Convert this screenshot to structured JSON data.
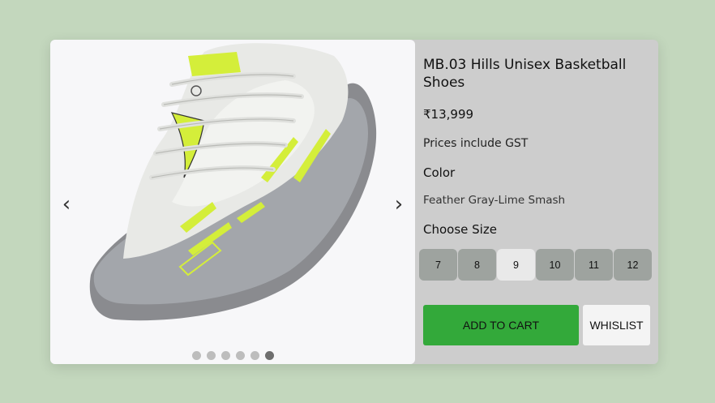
{
  "product": {
    "title": "MB.03 Hills Unisex Basketball Shoes",
    "price": "₹13,999",
    "tax_note": "Prices include GST",
    "color_label": "Color",
    "color_value": "Feather Gray-Lime Smash",
    "size_label": "Choose Size",
    "sizes": [
      "7",
      "8",
      "9",
      "10",
      "11",
      "12"
    ],
    "selected_size": "9"
  },
  "gallery": {
    "prev_arrow": "‹",
    "next_arrow": "›",
    "image_count": 6,
    "active_index": 6,
    "image_icon": "shoe-image"
  },
  "actions": {
    "add_to_cart": "ADD TO CART",
    "wishlist": "WHISLIST"
  },
  "colors": {
    "page_bg": "#c3d7bd",
    "card_bg": "#cdcdcd",
    "add_to_cart_bg": "#33a93a",
    "size_bg": "#9ea39f",
    "size_selected_bg": "#e9e9e9",
    "accent_lime": "#d4ee3a"
  }
}
